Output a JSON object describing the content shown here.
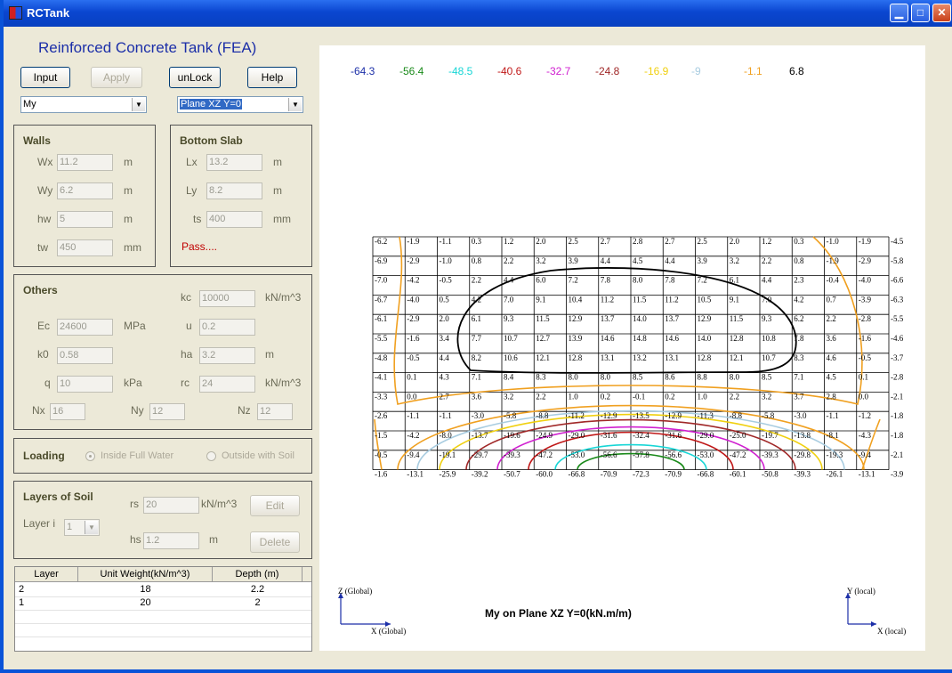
{
  "window": {
    "title": "RCTank"
  },
  "heading": "Reinforced Concrete Tank (FEA)",
  "toolbar": {
    "input": "Input",
    "apply": "Apply",
    "unlock": "unLock",
    "help": "Help"
  },
  "result_select": "My",
  "plane_select": "Plane XZ Y=0",
  "walls": {
    "title": "Walls",
    "fields": [
      {
        "label": "Wx",
        "value": "11.2",
        "unit": "m"
      },
      {
        "label": "Wy",
        "value": "6.2",
        "unit": "m"
      },
      {
        "label": "hw",
        "value": "5",
        "unit": "m"
      },
      {
        "label": "tw",
        "value": "450",
        "unit": "mm"
      }
    ]
  },
  "slab": {
    "title": "Bottom Slab",
    "fields": [
      {
        "label": "Lx",
        "value": "13.2",
        "unit": "m"
      },
      {
        "label": "Ly",
        "value": "8.2",
        "unit": "m"
      },
      {
        "label": "ts",
        "value": "400",
        "unit": "mm"
      }
    ],
    "status": "Pass....",
    "status_color": "#c00000"
  },
  "others": {
    "title": "Others",
    "kc": {
      "label": "kc",
      "value": "10000",
      "unit": "kN/m^3"
    },
    "ec": {
      "label": "Ec",
      "value": "24600",
      "unit": "MPa"
    },
    "u": {
      "label": "u",
      "value": "0.2"
    },
    "k0": {
      "label": "k0",
      "value": "0.58"
    },
    "ha": {
      "label": "ha",
      "value": "3.2",
      "unit": "m"
    },
    "q": {
      "label": "q",
      "value": "10",
      "unit": "kPa"
    },
    "rc": {
      "label": "rc",
      "value": "24",
      "unit": "kN/m^3"
    },
    "nx": {
      "label": "Nx",
      "value": "16"
    },
    "ny": {
      "label": "Ny",
      "value": "12"
    },
    "nz": {
      "label": "Nz",
      "value": "12"
    }
  },
  "loading": {
    "title": "Loading",
    "inside": "Inside Full Water",
    "outside": "Outside with Soil"
  },
  "soil": {
    "title": "Layers of Soil",
    "layer_label": "Layer i",
    "layer_value": "1",
    "rs": {
      "label": "rs",
      "value": "20",
      "unit": "kN/m^3"
    },
    "hs": {
      "label": "hs",
      "value": "1.2",
      "unit": "m"
    },
    "edit": "Edit",
    "delete": "Delete",
    "table": {
      "headers": [
        "Layer",
        "Unit Weight(kN/m^3)",
        "Depth (m)"
      ],
      "rows": [
        [
          "2",
          "18",
          "2.2"
        ],
        [
          "1",
          "20",
          "2"
        ]
      ]
    }
  },
  "plot": {
    "legend": [
      {
        "value": "-64.3",
        "color": "#1c2fa8"
      },
      {
        "value": "-56.4",
        "color": "#1a8a1a"
      },
      {
        "value": "-48.5",
        "color": "#18d6d6"
      },
      {
        "value": "-40.6",
        "color": "#c01818"
      },
      {
        "value": "-32.7",
        "color": "#d020d0"
      },
      {
        "value": "-24.8",
        "color": "#a02828"
      },
      {
        "value": "-16.9",
        "color": "#f0d010"
      },
      {
        "value": "-9",
        "color": "#a8cce0"
      },
      {
        "value": "-1.1",
        "color": "#f0a020"
      },
      {
        "value": "6.8",
        "color": "#000000"
      }
    ],
    "grid_values": [
      [
        "-6.2",
        "-1.9",
        "-1.1",
        "0.3",
        "1.2",
        "2.0",
        "2.5",
        "2.7",
        "2.8",
        "2.7",
        "2.5",
        "2.0",
        "1.2",
        "0.3",
        "-1.0",
        "-1.9",
        "-4.5"
      ],
      [
        "-6.9",
        "-2.9",
        "-1.0",
        "0.8",
        "2.2",
        "3.2",
        "3.9",
        "4.4",
        "4.5",
        "4.4",
        "3.9",
        "3.2",
        "2.2",
        "0.8",
        "-1.9",
        "-2.9",
        "-5.8"
      ],
      [
        "-7.0",
        "-4.2",
        "-0.5",
        "2.2",
        "4.4",
        "6.0",
        "7.2",
        "7.8",
        "8.0",
        "7.8",
        "7.2",
        "6.1",
        "4.4",
        "2.3",
        "-0.4",
        "-4.0",
        "-6.6"
      ],
      [
        "-6.7",
        "-4.0",
        "0.5",
        "4.2",
        "7.0",
        "9.1",
        "10.4",
        "11.2",
        "11.5",
        "11.2",
        "10.5",
        "9.1",
        "7.0",
        "4.2",
        "0.7",
        "-3.9",
        "-6.3"
      ],
      [
        "-6.1",
        "-2.9",
        "2.0",
        "6.1",
        "9.3",
        "11.5",
        "12.9",
        "13.7",
        "14.0",
        "13.7",
        "12.9",
        "11.5",
        "9.3",
        "6.2",
        "2.2",
        "-2.8",
        "-5.5"
      ],
      [
        "-5.5",
        "-1.6",
        "3.4",
        "7.7",
        "10.7",
        "12.7",
        "13.9",
        "14.6",
        "14.8",
        "14.6",
        "14.0",
        "12.8",
        "10.8",
        "7.8",
        "3.6",
        "-1.6",
        "-4.6"
      ],
      [
        "-4.8",
        "-0.5",
        "4.4",
        "8.2",
        "10.6",
        "12.1",
        "12.8",
        "13.1",
        "13.2",
        "13.1",
        "12.8",
        "12.1",
        "10.7",
        "8.3",
        "4.6",
        "-0.5",
        "-3.7"
      ],
      [
        "-4.1",
        "0.1",
        "4.3",
        "7.1",
        "8.4",
        "8.3",
        "8.0",
        "8.0",
        "8.5",
        "8.6",
        "8.8",
        "8.0",
        "8.5",
        "7.1",
        "4.5",
        "0.1",
        "-2.8"
      ],
      [
        "-3.3",
        "0.0",
        "2.7",
        "3.6",
        "3.2",
        "2.2",
        "1.0",
        "0.2",
        "-0.1",
        "0.2",
        "1.0",
        "2.2",
        "3.2",
        "3.7",
        "2.8",
        "0.0",
        "-2.1"
      ],
      [
        "-2.6",
        "-1.1",
        "-1.1",
        "-3.0",
        "-5.8",
        "-8.8",
        "-11.2",
        "-12.9",
        "-13.5",
        "-12.9",
        "-11.3",
        "-8.8",
        "-5.8",
        "-3.0",
        "-1.1",
        "-1.2",
        "-1.8"
      ],
      [
        "-1.5",
        "-4.2",
        "-8.0",
        "-13.7",
        "-19.6",
        "-24.9",
        "-29.0",
        "-31.6",
        "-32.4",
        "-31.6",
        "-29.0",
        "-25.0",
        "-19.7",
        "-13.8",
        "-8.1",
        "-4.3",
        "-1.8"
      ],
      [
        "-0.5",
        "-9.4",
        "-19.1",
        "-29.7",
        "-39.3",
        "-47.2",
        "-53.0",
        "-56.6",
        "-57.8",
        "-56.6",
        "-53.0",
        "-47.2",
        "-39.3",
        "-29.8",
        "-19.3",
        "-9.4",
        "-2.1"
      ],
      [
        "-1.6",
        "-13.1",
        "-25.9",
        "-39.2",
        "-50.7",
        "-60.0",
        "-66.8",
        "-70.9",
        "-72.3",
        "-70.9",
        "-66.8",
        "-60.1",
        "-50.8",
        "-39.3",
        "-26.1",
        "-13.1",
        "-3.9"
      ]
    ],
    "caption": "My on Plane  XZ Y=0(kN.m/m)",
    "global_z": "Z (Global)",
    "global_x": "X (Global)",
    "local_y": "Y (local)",
    "local_x": "X (local)"
  }
}
